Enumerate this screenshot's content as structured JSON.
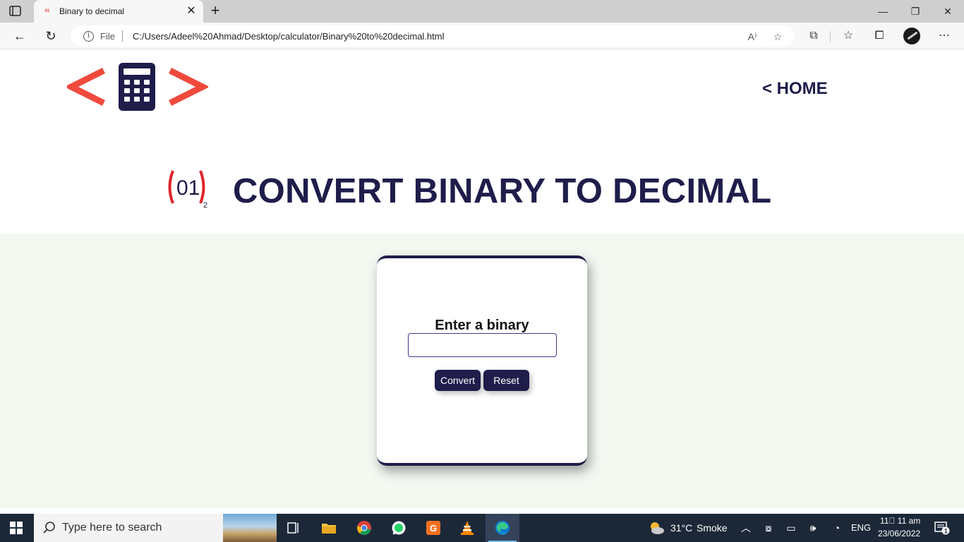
{
  "browser": {
    "tab_title": "Binary to decimal",
    "tab_favicon_text": "01",
    "address": {
      "prefix": "File",
      "url": "C:/Users/Adeel%20Ahmad/Desktop/calculator/Binary%20to%20decimal.html"
    }
  },
  "header": {
    "home_link": "< HOME",
    "colors": {
      "accent": "#f04a3c",
      "brand": "#1f1d4a"
    }
  },
  "main": {
    "title": "CONVERT BINARY TO DECIMAL",
    "icon_text": "01",
    "icon_subscript": "2",
    "form": {
      "label": "Enter a binary",
      "input_value": "",
      "convert_label": "Convert",
      "reset_label": "Reset"
    },
    "colors": {
      "band_background": "#f3f8f1"
    }
  },
  "taskbar": {
    "search_placeholder": "Type here to search",
    "weather": {
      "temp": "31°C",
      "condition": "Smoke"
    },
    "language": "ENG",
    "time": "11\u0000 11 am",
    "date": "23/06/2022",
    "notification_count": "1",
    "apps": [
      "task-view",
      "file-explorer",
      "chrome",
      "whatsapp",
      "foxit-pdf",
      "vlc",
      "edge"
    ]
  }
}
